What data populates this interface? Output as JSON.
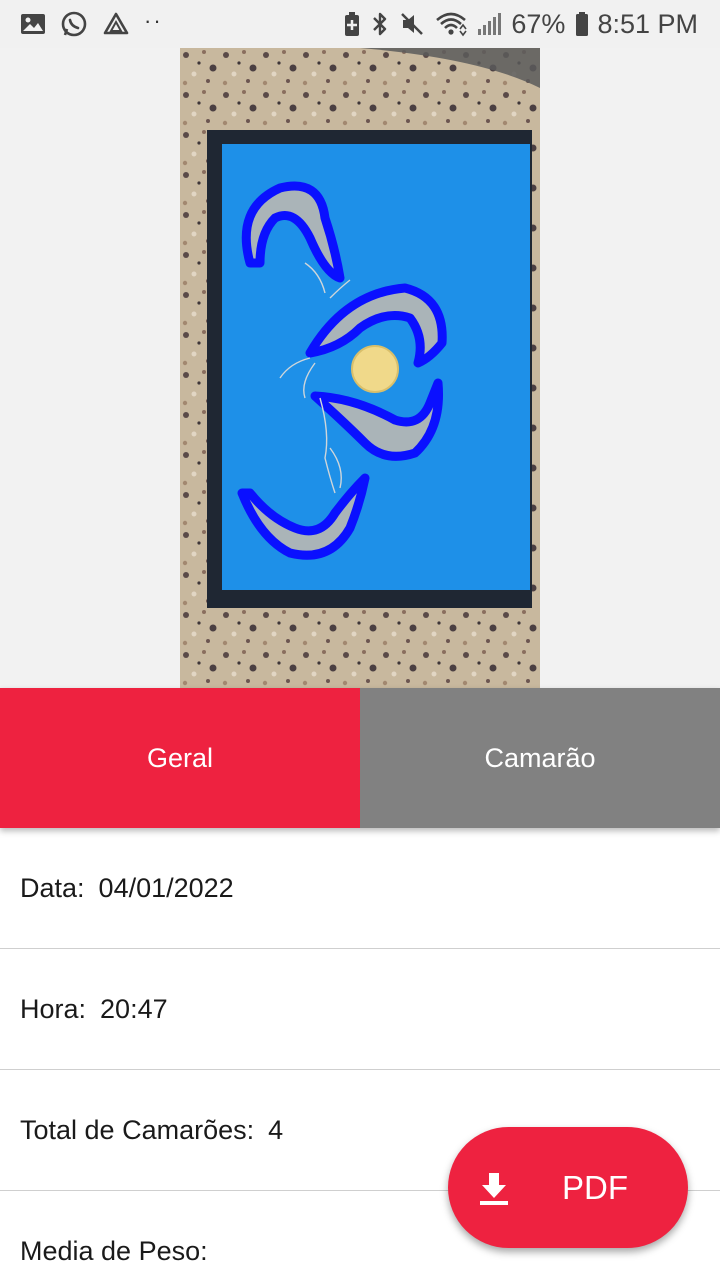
{
  "status_bar": {
    "battery": "67%",
    "time": "8:51 PM",
    "more_indicator": "··",
    "icons_left": [
      "gallery-icon",
      "whatsapp-icon",
      "drive-icon"
    ],
    "icons_right": [
      "battery-saver-icon",
      "bluetooth-icon",
      "mute-icon",
      "wifi-icon",
      "signal-icon",
      "battery-icon"
    ]
  },
  "photo": {
    "subject": "shrimp-detection-image",
    "detection_outline_color": "#0000ff",
    "board_color": "#1c8fe6"
  },
  "tabs": [
    {
      "label": "Geral",
      "selected": true,
      "color": "#ee2240"
    },
    {
      "label": "Camarão",
      "selected": false,
      "color": "#818181"
    }
  ],
  "info": {
    "data_label": "Data:",
    "data_value": "04/01/2022",
    "hora_label": "Hora:",
    "hora_value": "20:47",
    "total_label": "Total de Camarões:",
    "total_value": "4",
    "media_label": "Media de Peso:",
    "media_value": ""
  },
  "fab": {
    "label": "PDF",
    "icon": "download-icon",
    "color": "#ee2240"
  }
}
